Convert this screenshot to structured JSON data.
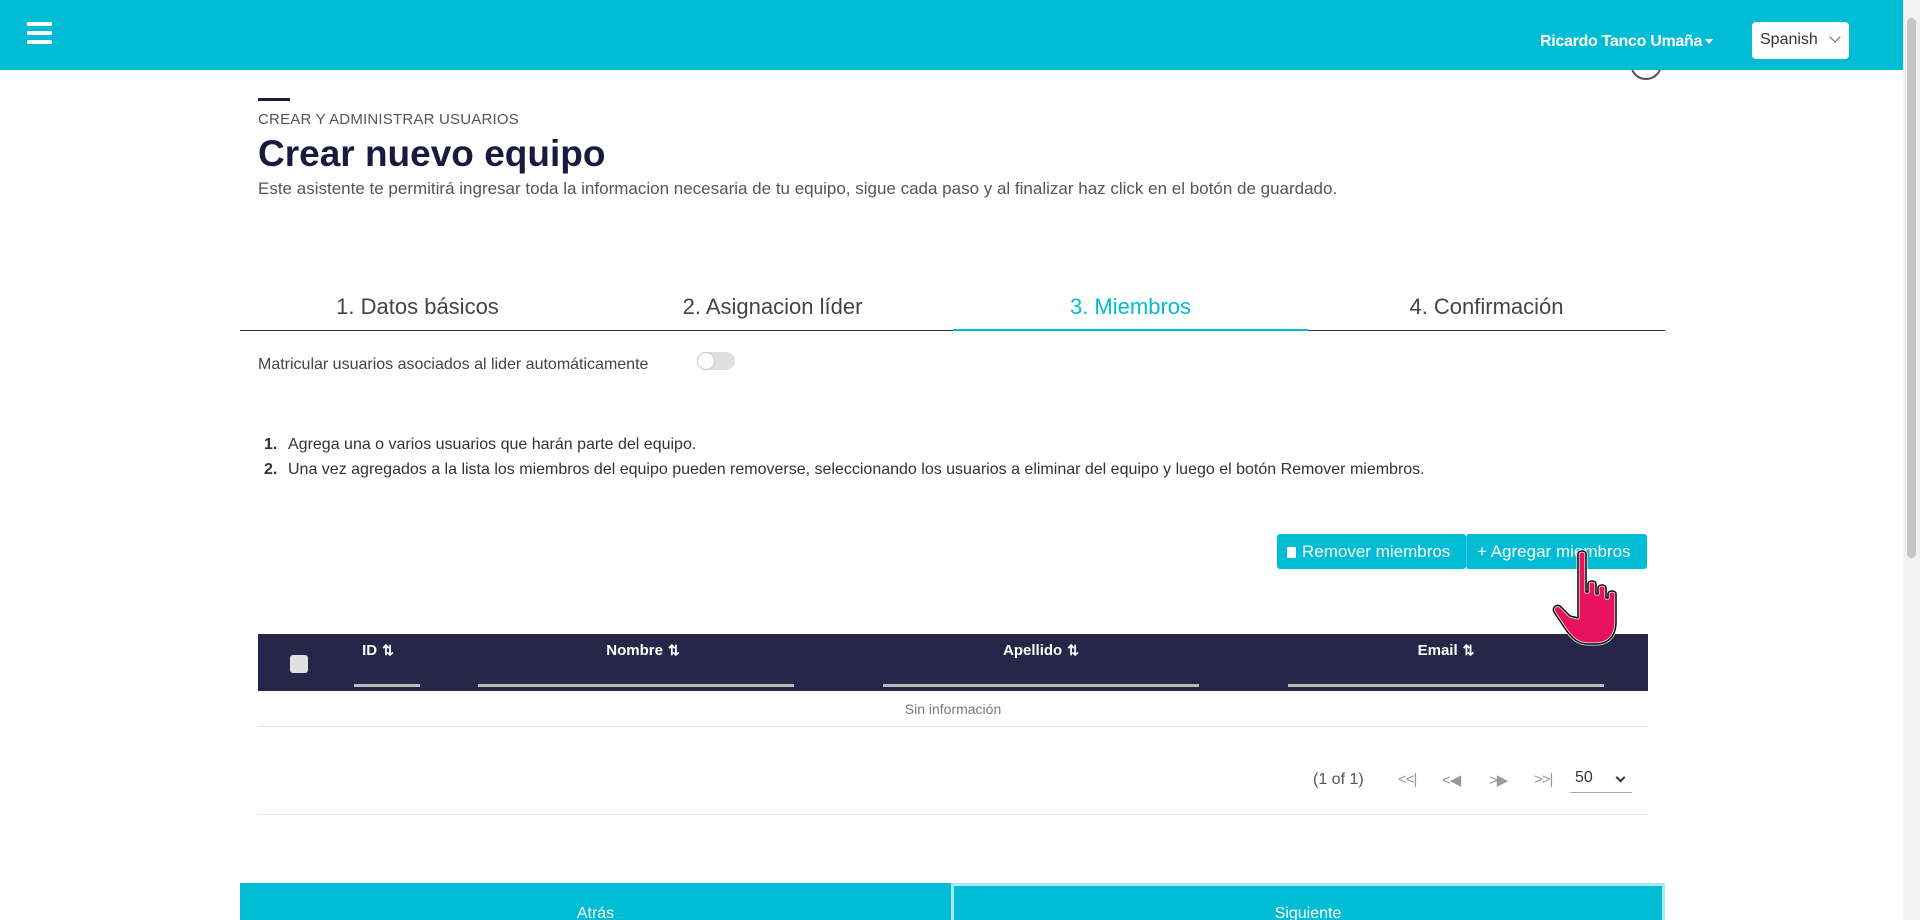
{
  "header": {
    "user_name": "Ricardo Tanco Umaña",
    "language": "Spanish"
  },
  "page": {
    "breadcrumb": "CREAR Y ADMINISTRAR USUARIOS",
    "title": "Crear nuevo equipo",
    "description": "Este asistente te permitirá ingresar toda la informacion necesaria de tu equipo, sigue cada paso y al finalizar haz click en el botón de guardado."
  },
  "stepper": {
    "steps": [
      {
        "label": "1. Datos básicos"
      },
      {
        "label": "2. Asignacion líder"
      },
      {
        "label": "3. Miembros"
      },
      {
        "label": "4. Confirmación"
      }
    ],
    "active_index": 2
  },
  "auto_enroll": {
    "label": "Matricular usuarios asociados al lider automáticamente",
    "enabled": false
  },
  "instructions": [
    {
      "num": "1.",
      "text": "Agrega una o varios usuarios que harán parte del equipo."
    },
    {
      "num": "2.",
      "text": "Una vez agregados a la lista los miembros del equipo pueden removerse, seleccionando los usuarios a eliminar del equipo y luego el botón Remover miembros."
    }
  ],
  "actions": {
    "remove_label": "Remover miembros",
    "add_label": "Agregar miembros"
  },
  "table": {
    "columns": [
      {
        "label": "ID"
      },
      {
        "label": "Nombre"
      },
      {
        "label": "Apellido"
      },
      {
        "label": "Email"
      }
    ],
    "sort_glyph": "⇅",
    "empty_message": "Sin información"
  },
  "paginator": {
    "report": "(1 of 1)",
    "rows_per_page": "50"
  },
  "footer": {
    "back_label": "Atrás",
    "next_label": "Siguiente"
  },
  "colors": {
    "accent": "#00bcd4",
    "table_header": "#272548",
    "title": "#1a1a3e"
  }
}
